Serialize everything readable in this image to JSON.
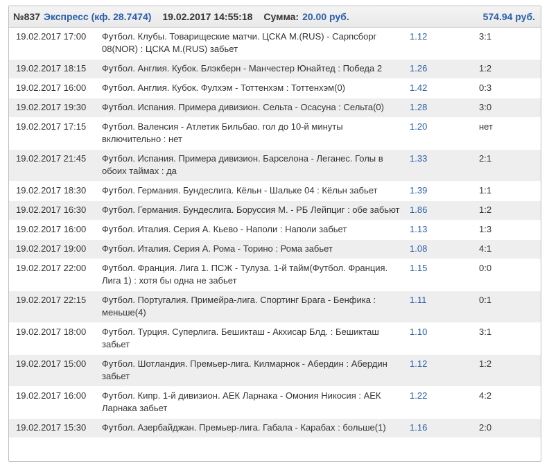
{
  "header": {
    "number": "№837",
    "type": "Экспресс (кф. 28.7474)",
    "datetime": "19.02.2017 14:55:18",
    "sum_label": "Сумма:",
    "sum_value": "20.00 руб.",
    "win": "574.94 руб."
  },
  "rows": [
    {
      "date": "19.02.2017 17:00",
      "event": "Футбол. Клубы. Товарищеские матчи. ЦСКА М.(RUS) - Сарпсборг 08(NOR) : ЦСКА М.(RUS) забьет",
      "coef": "1.12",
      "score": "3:1"
    },
    {
      "date": "19.02.2017 18:15",
      "event": "Футбол. Англия. Кубок. Блэкберн - Манчестер Юнайтед : Победа 2",
      "coef": "1.26",
      "score": "1:2"
    },
    {
      "date": "19.02.2017 16:00",
      "event": "Футбол. Англия. Кубок. Фулхэм - Тоттенхэм : Тоттенхэм(0)",
      "coef": "1.42",
      "score": "0:3"
    },
    {
      "date": "19.02.2017 19:30",
      "event": "Футбол. Испания. Примера дивизион. Сельта - Осасуна : Сельта(0)",
      "coef": "1.28",
      "score": "3:0"
    },
    {
      "date": "19.02.2017 17:15",
      "event": "Футбол. Валенсия - Атлетик Бильбао. гол до 10-й минуты включительно : нет",
      "coef": "1.20",
      "score": "нет"
    },
    {
      "date": "19.02.2017 21:45",
      "event": "Футбол. Испания. Примера дивизион. Барселона - Леганес. Голы в обоих таймах : да",
      "coef": "1.33",
      "score": "2:1"
    },
    {
      "date": "19.02.2017 18:30",
      "event": "Футбол. Германия. Бундеслига. Кёльн - Шальке 04 : Кёльн забьет",
      "coef": "1.39",
      "score": "1:1"
    },
    {
      "date": "19.02.2017 16:30",
      "event": "Футбол. Германия. Бундеслига. Боруссия М. - РБ Лейпциг : обе забьют",
      "coef": "1.86",
      "score": "1:2"
    },
    {
      "date": "19.02.2017 16:00",
      "event": "Футбол. Италия. Серия А. Кьево - Наполи : Наполи забьет",
      "coef": "1.13",
      "score": "1:3"
    },
    {
      "date": "19.02.2017 19:00",
      "event": "Футбол. Италия. Серия А. Рома - Торино : Рома забьет",
      "coef": "1.08",
      "score": "4:1"
    },
    {
      "date": "19.02.2017 22:00",
      "event": "Футбол. Франция. Лига 1. ПСЖ - Тулуза. 1-й тайм(Футбол. Франция. Лига 1) : хотя бы одна не забьет",
      "coef": "1.15",
      "score": "0:0"
    },
    {
      "date": "19.02.2017 22:15",
      "event": "Футбол. Португалия. Примейра-лига. Спортинг Брага - Бенфика : меньше(4)",
      "coef": "1.11",
      "score": "0:1"
    },
    {
      "date": "19.02.2017 18:00",
      "event": "Футбол. Турция. Суперлига. Бешикташ - Акхисар Блд. : Бешикташ забьет",
      "coef": "1.10",
      "score": "3:1"
    },
    {
      "date": "19.02.2017 15:00",
      "event": "Футбол. Шотландия. Премьер-лига. Килмарнок - Абердин : Абердин забьет",
      "coef": "1.12",
      "score": "1:2"
    },
    {
      "date": "19.02.2017 16:00",
      "event": "Футбол. Кипр. 1-й дивизион. АЕК Ларнака - Омония Никосия : АЕК Ларнака забьет",
      "coef": "1.22",
      "score": "4:2"
    },
    {
      "date": "19.02.2017 15:30",
      "event": "Футбол. Азербайджан. Премьер-лига. Габала - Карабах : больше(1)",
      "coef": "1.16",
      "score": "2:0"
    }
  ]
}
